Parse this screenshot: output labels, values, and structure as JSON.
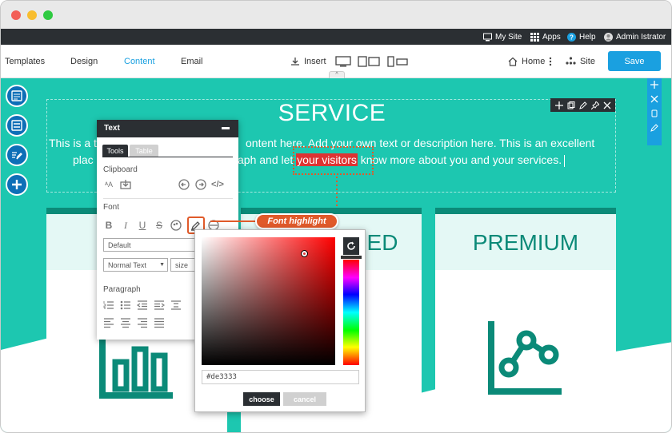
{
  "window": {
    "controls": [
      "close",
      "minimize",
      "zoom"
    ],
    "colors": {
      "close": "#f25f57",
      "minimize": "#f8bd2f",
      "zoom": "#2fca41"
    }
  },
  "adminbar": {
    "my_site": "My Site",
    "apps": "Apps",
    "help": "Help",
    "user": "Admin Istrator"
  },
  "menubar": {
    "tabs": [
      {
        "label": "Templates",
        "active": false
      },
      {
        "label": "Design",
        "active": false
      },
      {
        "label": "Content",
        "active": true
      },
      {
        "label": "Email",
        "active": false
      }
    ],
    "insert": "Insert",
    "devices": [
      "desktop-icon",
      "tablet-landscape-icon",
      "tablet-portrait-icon",
      "mobile-icon"
    ],
    "home": "Home",
    "site": "Site",
    "save": "Save"
  },
  "left_tools": [
    "layout-icon",
    "section-icon",
    "edit-text-icon",
    "add-icon"
  ],
  "right_tools": [
    "move-icon",
    "close-icon",
    "copy-icon",
    "edit-icon"
  ],
  "hero": {
    "title": "SERVICE",
    "line1_a": "This is a t",
    "line1_b": "ontent here. Add your own text or description here. This is an excellent",
    "line2_a": "plac",
    "line2_b": "aph and let ",
    "highlighted": "your visitors",
    "line2_c": " know more about you and your services."
  },
  "element_toolbar": [
    "move-icon",
    "copy-icon",
    "edit-icon",
    "pin-icon",
    "close-icon"
  ],
  "cards": [
    {
      "title": "",
      "price": "",
      "icon": "bar-chart-icon"
    },
    {
      "title": "ED",
      "price": "",
      "icon": "bar-chart-icon"
    },
    {
      "title": "PREMIUM",
      "price": "",
      "icon": "line-graph-icon"
    }
  ],
  "text_panel": {
    "title": "Text",
    "tabs": [
      {
        "label": "Tools",
        "active": true
      },
      {
        "label": "Table",
        "active": false
      }
    ],
    "clipboard_label": "Clipboard",
    "font_label": "Font",
    "font_buttons": [
      "B",
      "I",
      "U",
      "S"
    ],
    "font_family": "Default",
    "text_style": "Normal Text",
    "size_placeholder": "size",
    "paragraph_label": "Paragraph"
  },
  "callout": {
    "label": "Font highlight"
  },
  "color_picker": {
    "hex": "#de3333",
    "choose": "choose",
    "cancel": "cancel",
    "selected_color": "#de3333"
  },
  "accent": {
    "teal": "#1dc7b0",
    "dark_teal": "#0b8a78",
    "blue": "#1aa0e0",
    "orange": "#e05a2a"
  }
}
